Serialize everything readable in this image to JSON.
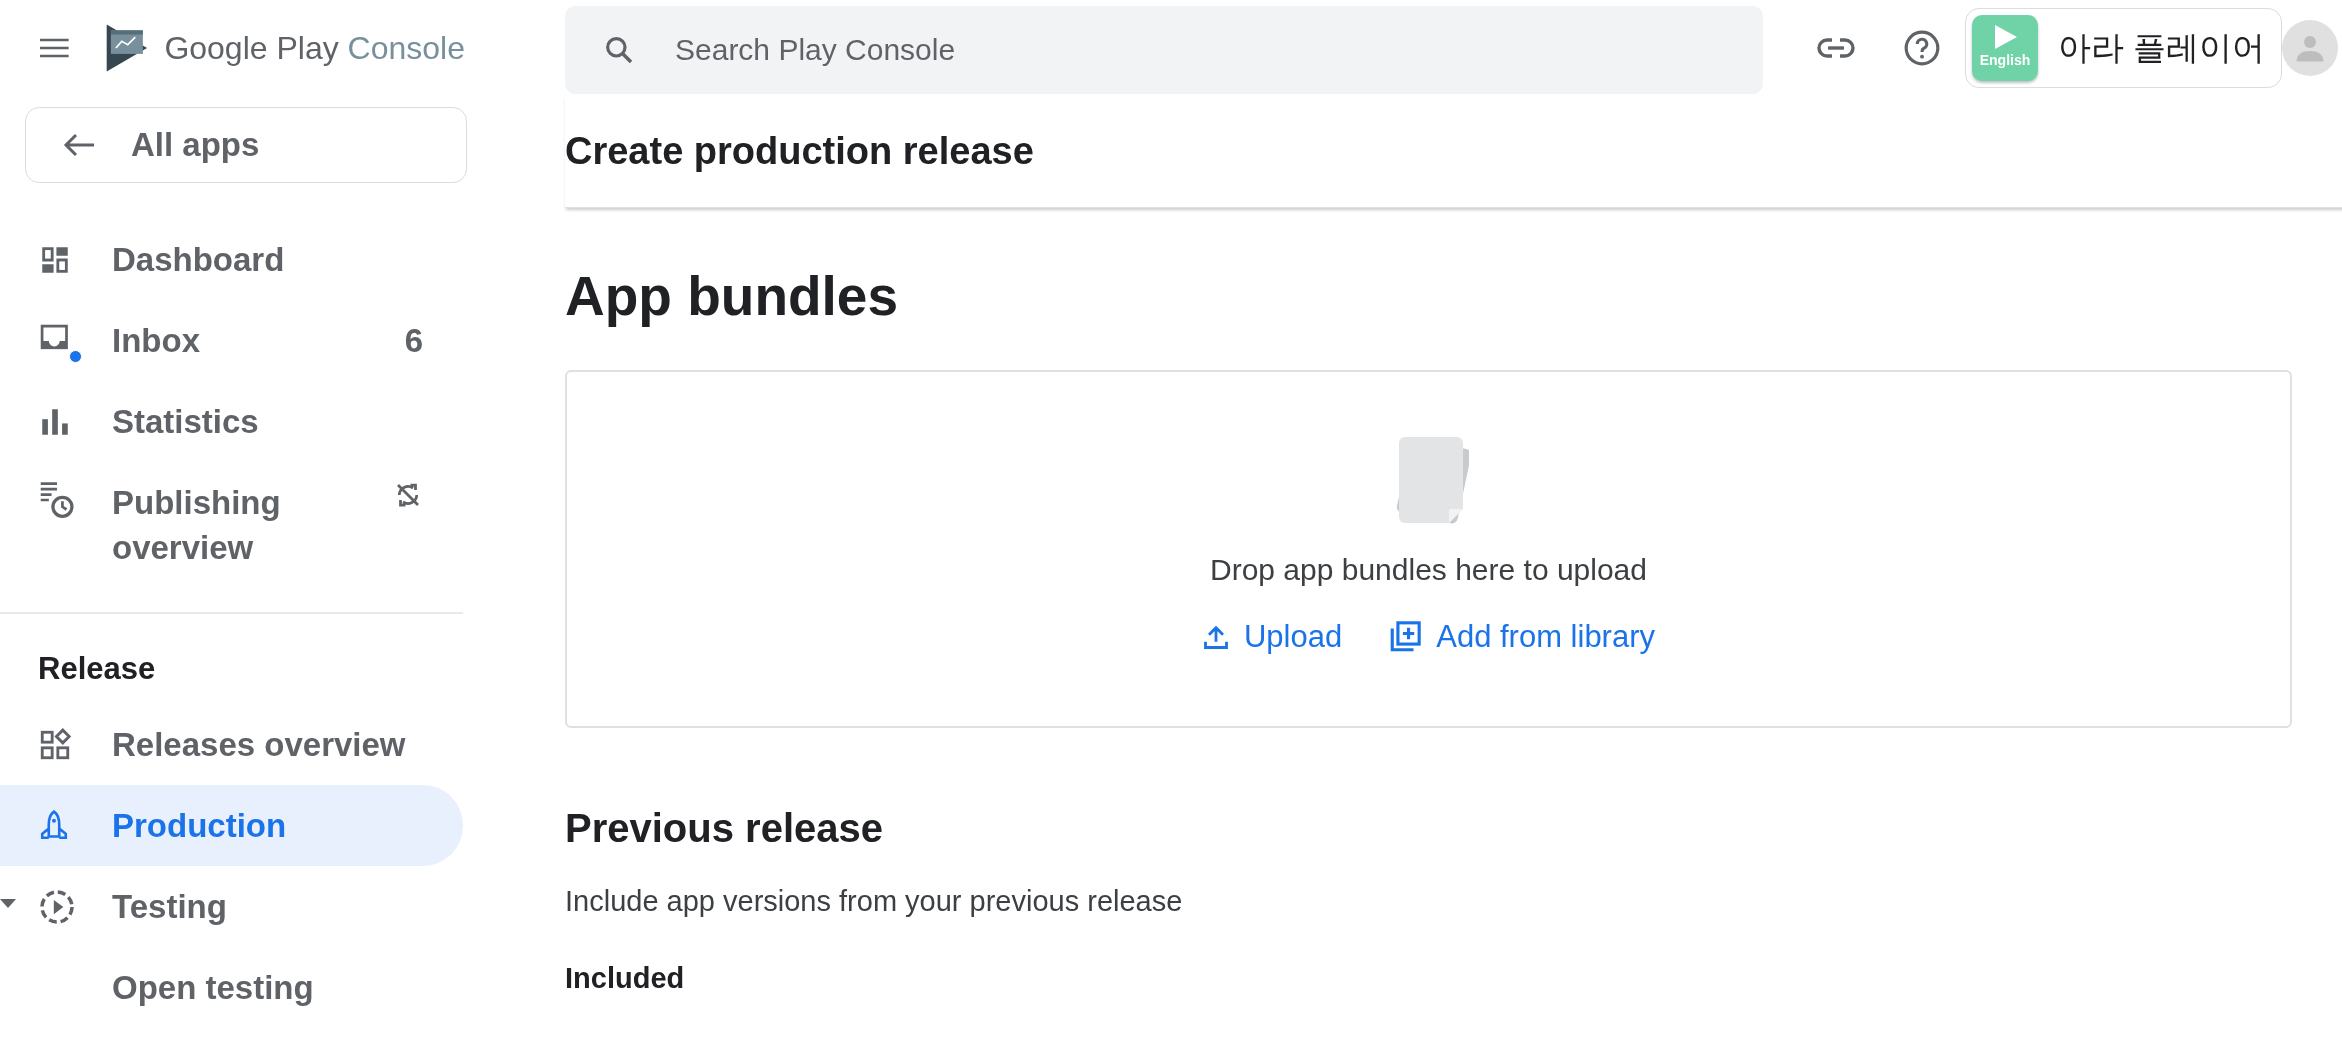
{
  "topbar": {
    "brand": "Google Play",
    "brand_suffix": "Console",
    "search": {
      "placeholder": "Search Play Console"
    },
    "account": {
      "app_icon_label": "English",
      "name": "아라 플레이어"
    }
  },
  "sidebar": {
    "back_link": "All apps",
    "items": [
      {
        "label": "Dashboard",
        "selected": false,
        "unread": false
      },
      {
        "label": "Inbox",
        "count": "6",
        "selected": false,
        "unread": true
      },
      {
        "label": "Statistics",
        "selected": false,
        "unread": false
      },
      {
        "label": "Publishing overview",
        "selected": false,
        "unread": false
      }
    ],
    "section": {
      "title": "Release",
      "items": [
        {
          "label": "Releases overview",
          "selected": false
        },
        {
          "label": "Production",
          "selected": true
        },
        {
          "label": "Testing",
          "selected": false,
          "expanded": true,
          "children": [
            {
              "label": "Open testing",
              "selected": false
            }
          ]
        }
      ]
    }
  },
  "main": {
    "page_title": "Create production release",
    "bundles": {
      "heading": "App bundles",
      "drop_text": "Drop app bundles here to upload",
      "actions": [
        "Upload",
        "Add from library"
      ]
    },
    "previous_release": {
      "heading": "Previous release",
      "description": "Include app versions from your previous release",
      "included_label": "Included"
    }
  }
}
